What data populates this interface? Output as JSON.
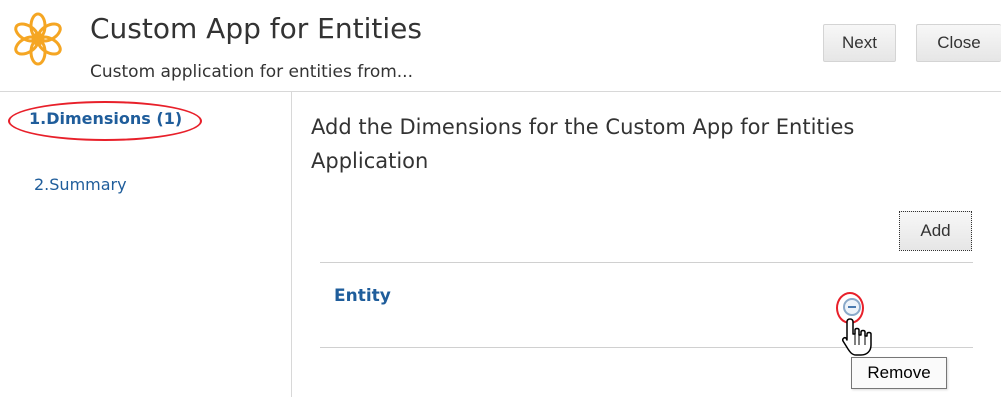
{
  "header": {
    "title": "Custom App for Entities",
    "subtitle": "Custom application for entities from...",
    "icon": "flower-icon",
    "next_label": "Next",
    "close_label": "Close"
  },
  "train": {
    "steps": [
      {
        "label": "1.Dimensions (1)",
        "active": true
      },
      {
        "label": "2.Summary",
        "active": false
      }
    ]
  },
  "main": {
    "heading": "Add the Dimensions for the Custom App for Entities Application",
    "add_label": "Add",
    "dimensions": [
      {
        "name": "Entity",
        "action_icon": "remove-icon"
      }
    ],
    "tooltip": "Remove"
  },
  "colors": {
    "link": "#1f5d9b",
    "highlight": "#e8202a",
    "icon_orange": "#f5a623"
  }
}
